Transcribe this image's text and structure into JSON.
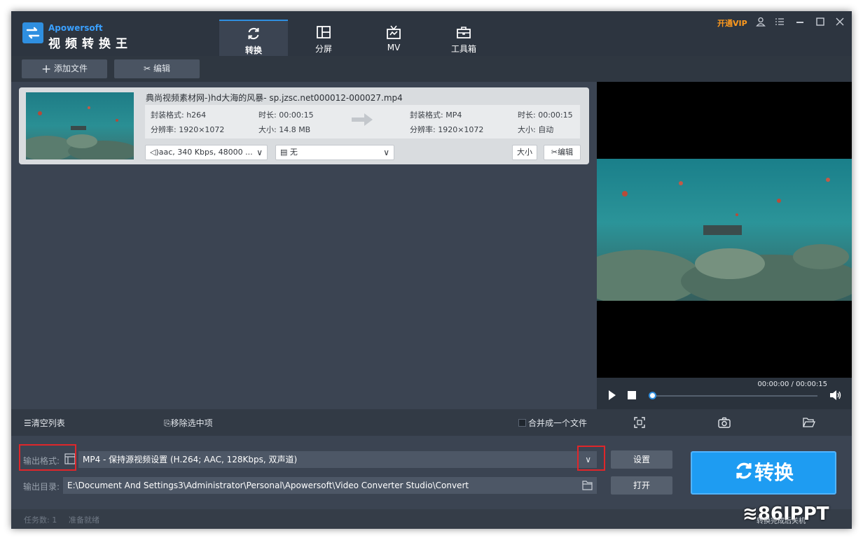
{
  "app": {
    "brand_en": "Apowersoft",
    "brand_cn": "视频转换王",
    "vip": "开通VIP"
  },
  "tabs": [
    {
      "label": "转换",
      "icon": "refresh-icon",
      "active": true
    },
    {
      "label": "分屏",
      "icon": "split-screen-icon"
    },
    {
      "label": "MV",
      "icon": "tv-icon"
    },
    {
      "label": "工具箱",
      "icon": "toolbox-icon"
    }
  ],
  "toolbar": {
    "add_file": "添加文件",
    "edit": "编辑"
  },
  "file": {
    "name": "典尚视频素材网-)hd大海的风暴- sp.jzsc.net000012-000027.mp4",
    "src_format": "封装格式: h264",
    "src_duration": "时长: 00:00:15",
    "src_resolution": "分辨率: 1920×1072",
    "src_size": "大小: 14.8 MB",
    "dst_format": "封装格式: MP4",
    "dst_duration": "时长: 00:00:15",
    "dst_resolution": "分辨率: 1920×1072",
    "dst_size": "大小: 自动",
    "audio": "aac, 340 Kbps, 48000 ...",
    "subtitle": "无",
    "size_btn": "大小",
    "edit_btn": "编辑"
  },
  "player": {
    "timecode": "00:00:00 / 00:00:15",
    "progress": 0
  },
  "list_actions": {
    "clear": "清空列表",
    "remove": "移除选中项",
    "merge": "合并成一个文件"
  },
  "output": {
    "format_label": "输出格式:",
    "format_value": "MP4 - 保持源视频设置 (H.264; AAC, 128Kbps, 双声道)",
    "dir_label": "输出目录:",
    "dir_value": "E:\\Document And Settings3\\Administrator\\Personal\\Apowersoft\\Video Converter Studio\\Convert",
    "settings_btn": "设置",
    "open_btn": "打开",
    "convert_btn": "转换"
  },
  "status": {
    "tasks": "任务数: 1",
    "state": "准备就绪"
  },
  "watermark": {
    "logo": "86IPPT",
    "sub": "转换完成后关机"
  },
  "colors": {
    "accent": "#1e9cf2",
    "vip": "#ff9a1e",
    "highlight": "#e0262a"
  }
}
